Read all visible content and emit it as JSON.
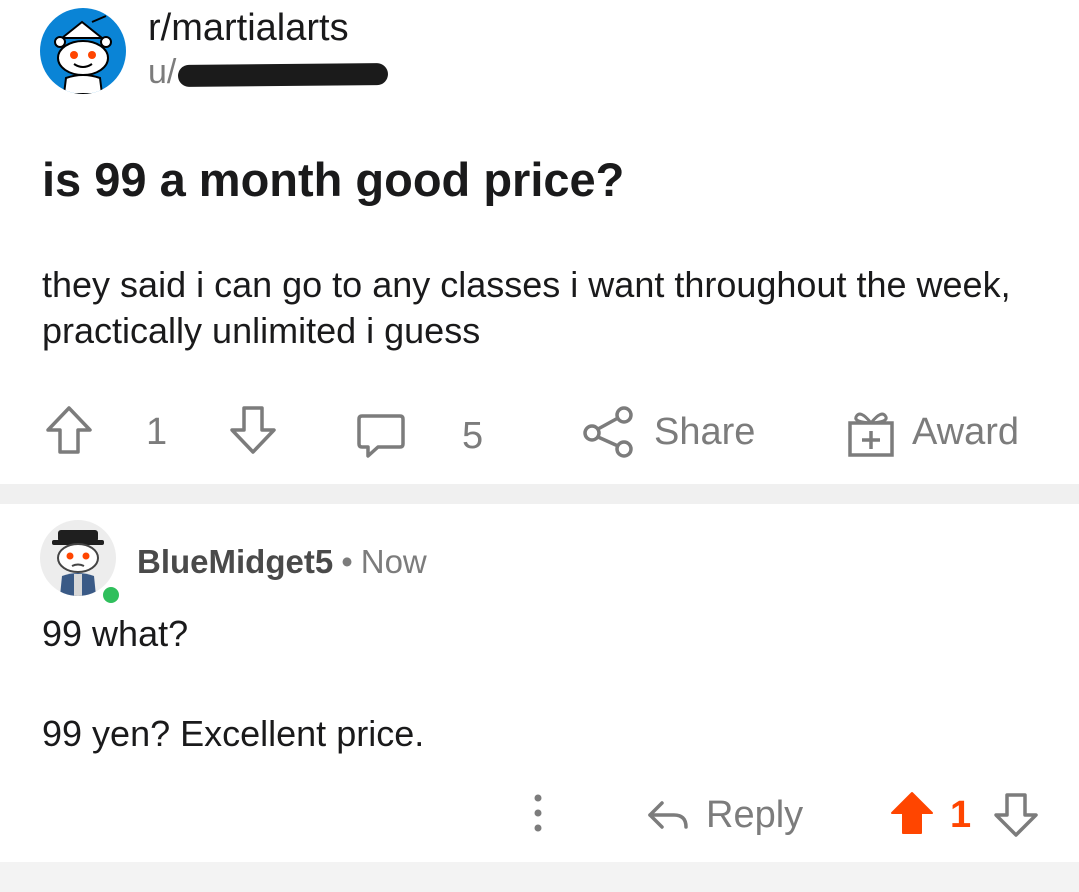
{
  "post": {
    "subreddit": "r/martialarts",
    "user_prefix": "u/",
    "title": "is 99 a month good price?",
    "body": "they said i can go to any classes i want throughout the week, practically unlimited i guess",
    "vote_count": "1",
    "comment_count": "5",
    "share_label": "Share",
    "award_label": "Award"
  },
  "comment": {
    "author": "BlueMidget5",
    "separator": "•",
    "time": "Now",
    "line1": "99 what?",
    "line2": "99 yen? Excellent price.",
    "reply_label": "Reply",
    "vote_count": "1",
    "more_icon": "vertical-ellipsis-icon"
  },
  "colors": {
    "muted": "#7c7c7c",
    "upvote_active": "#ff4500",
    "subreddit_avatar": "#0a84d6",
    "online": "#2fbf5c",
    "divider": "#f0f0f0"
  }
}
